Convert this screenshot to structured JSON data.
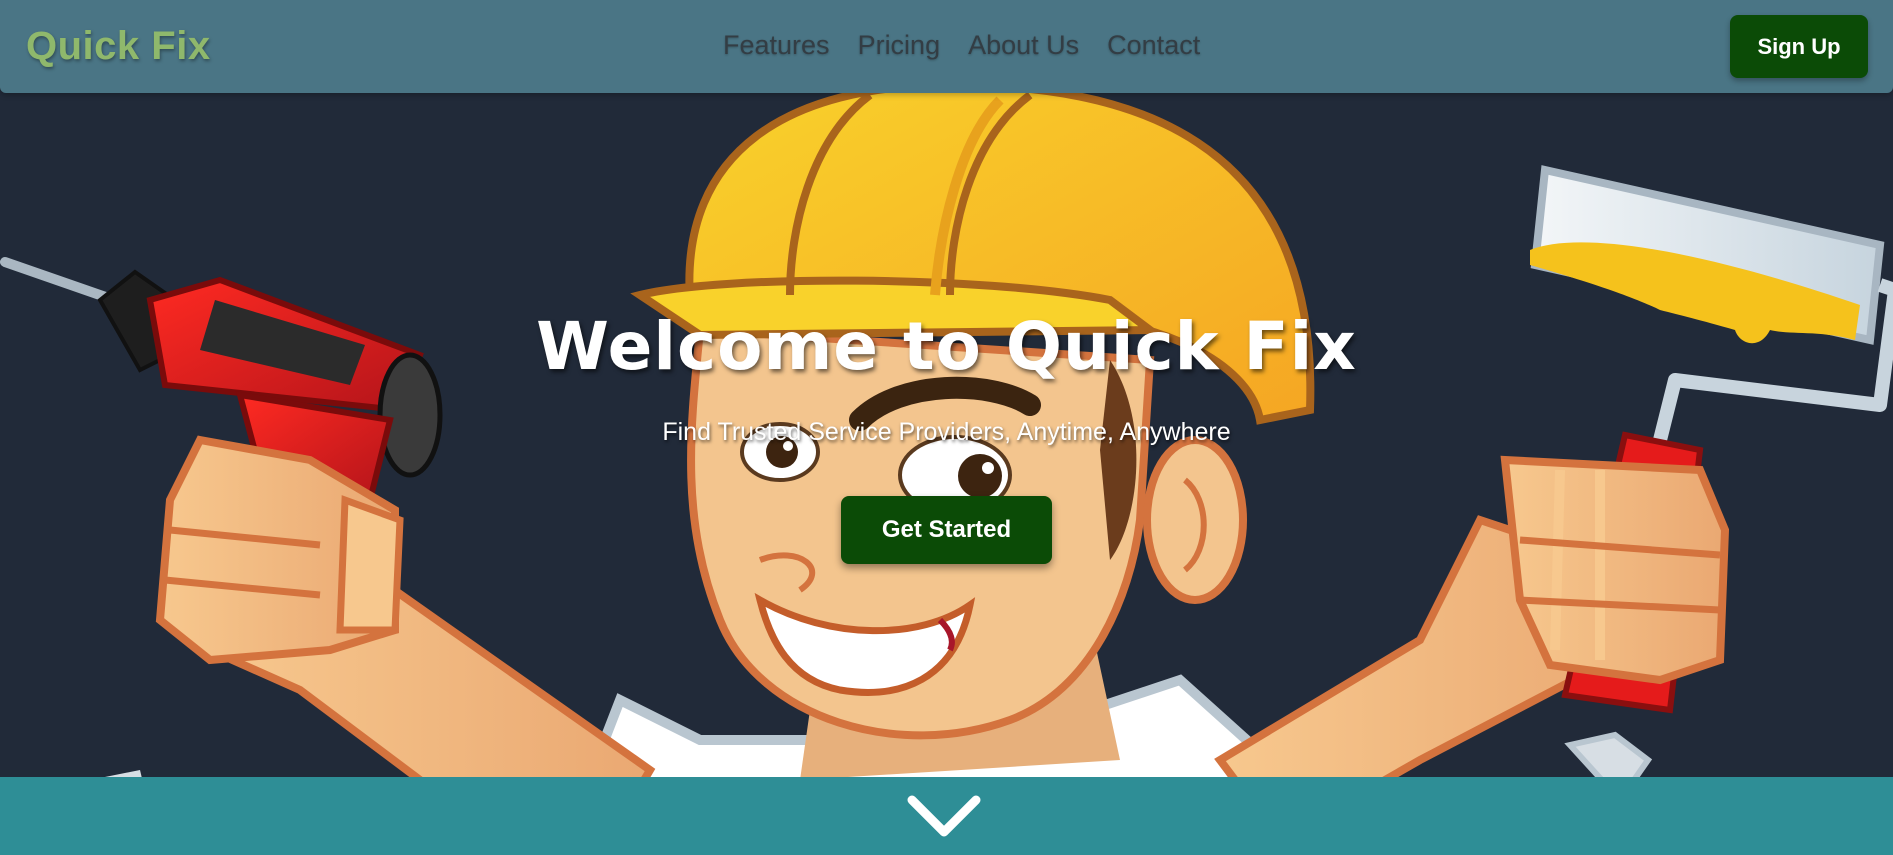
{
  "header": {
    "brand": "Quick Fix",
    "nav": [
      {
        "label": "Features"
      },
      {
        "label": "Pricing"
      },
      {
        "label": "About Us"
      },
      {
        "label": "Contact"
      }
    ],
    "signup_label": "Sign Up"
  },
  "hero": {
    "title": "Welcome to Quick Fix",
    "subtitle": "Find Trusted Service Providers, Anytime, Anywhere",
    "cta_label": "Get Started",
    "illustration": "handyman-mascot-illustration"
  },
  "footer_bar": {
    "icon": "chevron-down-icon"
  },
  "colors": {
    "header_bg": "#4a7585",
    "brand": "#8fb86c",
    "button_bg": "#0b4b06",
    "hero_bg": "#212a39",
    "bottom_bar_bg": "#2e8e96"
  }
}
